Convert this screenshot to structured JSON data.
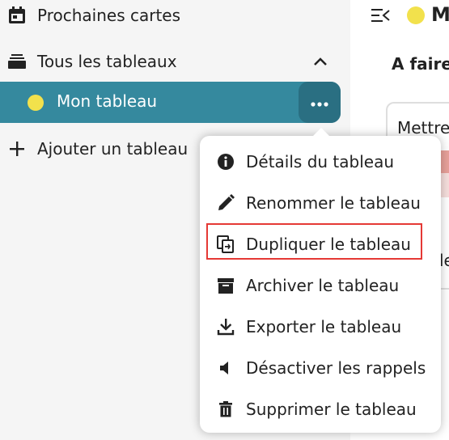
{
  "sidebar": {
    "upcoming": {
      "label": "Prochaines cartes",
      "icon": "calendar-icon"
    },
    "all_boards": {
      "label": "Tous les tableaux",
      "icon": "stack-icon",
      "chevron_icon": "chevron-up-icon"
    },
    "active_board": {
      "label": "Mon tableau",
      "color": "#f2e14c",
      "more_icon": "more-dots-icon"
    },
    "add_board": {
      "label": "Ajouter un tableau",
      "icon": "plus-icon"
    }
  },
  "main": {
    "board_title": "M",
    "column_title": "A faire",
    "card_text": "Mettre",
    "card_hint": "le"
  },
  "menu": {
    "items": [
      {
        "label": "Détails du tableau",
        "icon": "info-icon"
      },
      {
        "label": "Renommer le tableau",
        "icon": "pencil-icon"
      },
      {
        "label": "Dupliquer le tableau",
        "icon": "duplicate-icon"
      },
      {
        "label": "Archiver le tableau",
        "icon": "archive-icon"
      },
      {
        "label": "Exporter le tableau",
        "icon": "download-icon"
      },
      {
        "label": "Désactiver les rappels",
        "icon": "mute-icon"
      },
      {
        "label": "Supprimer le tableau",
        "icon": "trash-icon"
      }
    ],
    "highlight_color": "#e53935"
  },
  "colors": {
    "accent": "#35899e",
    "accent_dark": "#2a6f82",
    "board_dot": "#f2e14c"
  }
}
